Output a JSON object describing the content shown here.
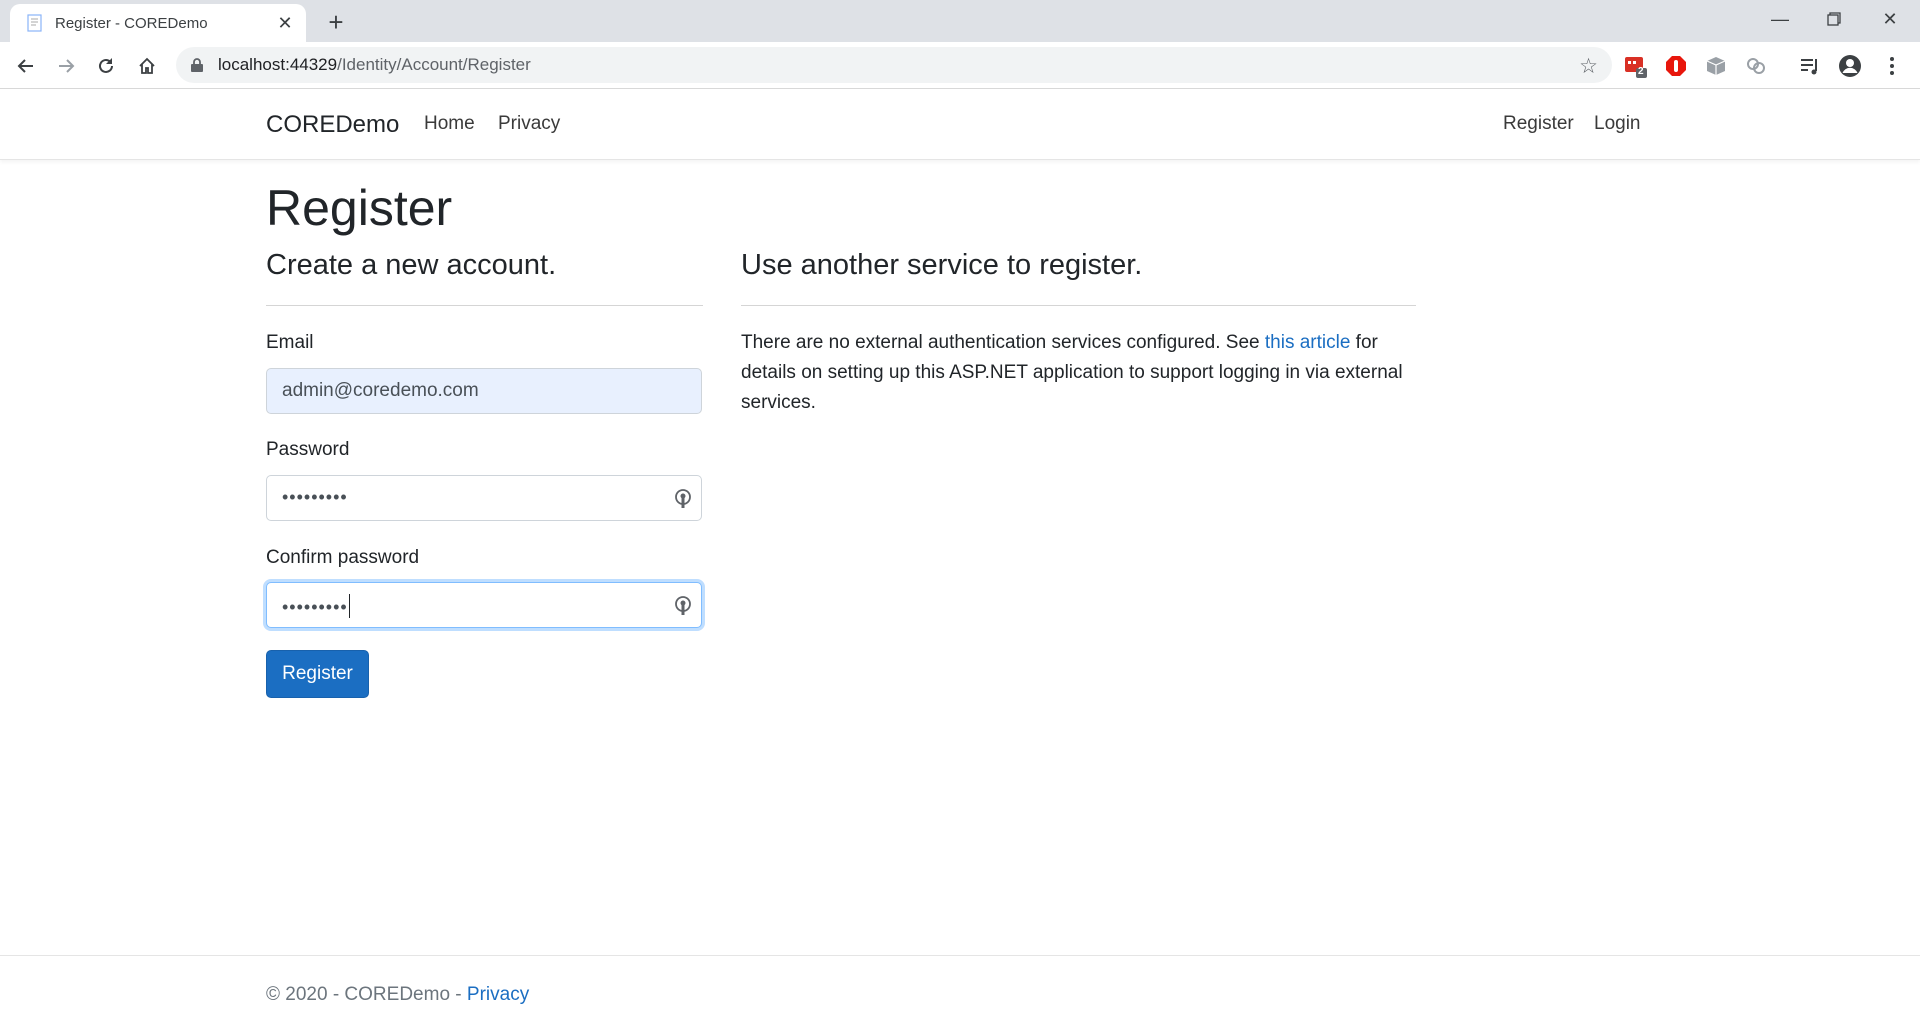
{
  "browser": {
    "tab_title": "Register - COREDemo",
    "url_host": "localhost:44329",
    "url_path": "/Identity/Account/Register",
    "extension_badge": "2"
  },
  "site": {
    "brand": "COREDemo",
    "nav": {
      "home": "Home",
      "privacy": "Privacy",
      "register": "Register",
      "login": "Login"
    }
  },
  "page": {
    "title": "Register",
    "left_heading": "Create a new account.",
    "right_heading": "Use another service to register.",
    "form": {
      "email_label": "Email",
      "email_value": "admin@coredemo.com",
      "password_label": "Password",
      "password_value": "•••••••••",
      "confirm_label": "Confirm password",
      "confirm_value": "•••••••••",
      "submit_label": "Register"
    },
    "external": {
      "text_before": "There are no external authentication services configured. See ",
      "link_text": "this article",
      "text_after": " for details on setting up this ASP.NET application to support logging in via external services."
    }
  },
  "footer": {
    "text": "© 2020 - COREDemo - ",
    "privacy": "Privacy"
  },
  "colors": {
    "primary": "#1b6ec2",
    "autofill": "#e8f0fe",
    "chrome_bg": "#dee1e6"
  }
}
